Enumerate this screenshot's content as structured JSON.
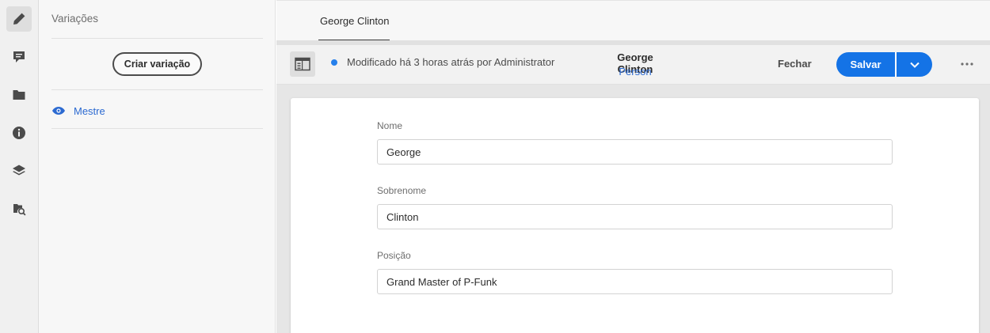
{
  "rail": {
    "items": [
      {
        "name": "edit-icon"
      },
      {
        "name": "comment-icon"
      },
      {
        "name": "folder-icon"
      },
      {
        "name": "info-icon"
      },
      {
        "name": "layers-icon"
      },
      {
        "name": "references-search-icon"
      }
    ]
  },
  "variations": {
    "title": "Variações",
    "create_label": "Criar variação",
    "master_label": "Mestre"
  },
  "tabs": [
    {
      "label": "George Clinton"
    }
  ],
  "actionbar": {
    "status": "Modificado há 3 horas atrás por Administrator",
    "entity_title": "George Clinton",
    "entity_type": "Person",
    "close_label": "Fechar",
    "save_label": "Salvar"
  },
  "form": {
    "fields": [
      {
        "label": "Nome",
        "value": "George"
      },
      {
        "label": "Sobrenome",
        "value": "Clinton"
      },
      {
        "label": "Posição",
        "value": "Grand Master of P-Funk"
      }
    ]
  },
  "colors": {
    "accent": "#1473e6",
    "link": "#2c6ad1",
    "status_dot": "#2680eb"
  }
}
